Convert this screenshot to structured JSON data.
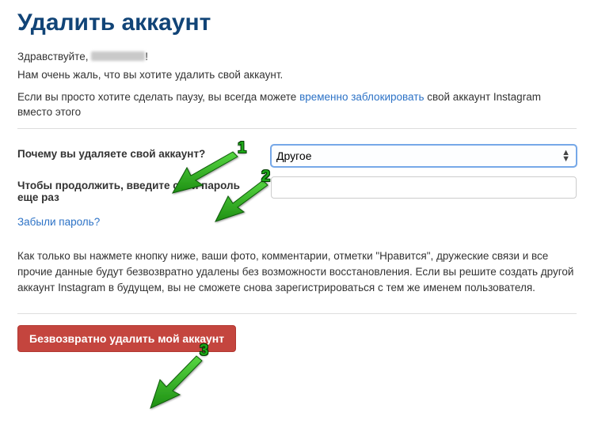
{
  "title": "Удалить аккаунт",
  "greeting_prefix": "Здравствуйте, ",
  "greeting_suffix": "!",
  "sorry_text": "Нам очень жаль, что вы хотите удалить свой аккаунт.",
  "pause_text_before": "Если вы просто хотите сделать паузу, вы всегда можете ",
  "pause_link": "временно заблокировать",
  "pause_text_after": " свой аккаунт Instagram вместо этого",
  "form": {
    "reason_label": "Почему вы удаляете свой аккаунт?",
    "reason_selected": "Другое",
    "password_label": "Чтобы продолжить, введите свой пароль еще раз",
    "password_value": "",
    "forgot_link": "Забыли пароль?"
  },
  "warning_text": "Как только вы нажмете кнопку ниже, ваши фото, комментарии, отметки \"Нравится\", дружеские связи и все прочие данные будут безвозвратно удалены без возможности восстановления. Если вы решите создать другой аккаунт Instagram в будущем, вы не сможете снова зарегистрироваться с тем же именем пользователя.",
  "delete_button": "Безвозвратно удалить мой аккаунт",
  "annotations": {
    "n1": "1",
    "n2": "2",
    "n3": "3"
  }
}
